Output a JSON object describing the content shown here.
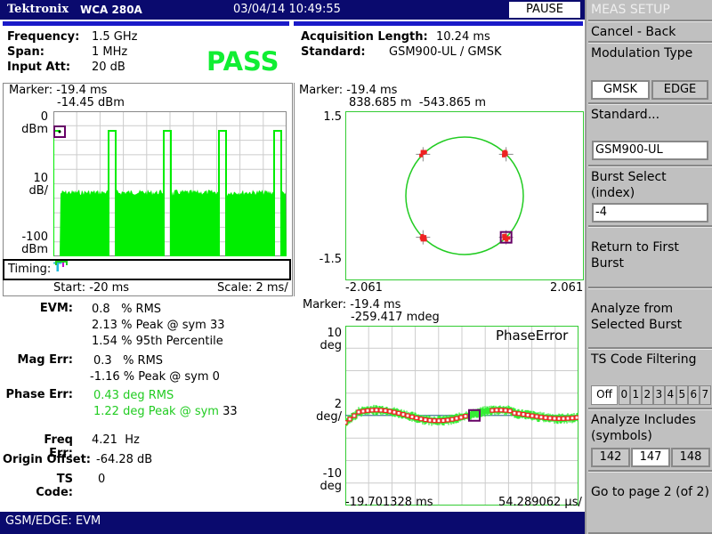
{
  "titlebar": {
    "brand": "Tektronix",
    "model": "WCA 280A",
    "datetime": "03/04/14 10:49:55",
    "pause_label": "PAUSE"
  },
  "header": {
    "frequency_label": "Frequency:",
    "frequency": "1.5 GHz",
    "span_label": "Span:",
    "span": "1 MHz",
    "input_att_label": "Input Att:",
    "input_att": "20 dB",
    "verdict": "PASS",
    "acq_label": "Acquisition Length:",
    "acq": "10.24 ms",
    "standard_label": "Standard:",
    "standard": "GSM900-UL / GMSK"
  },
  "power_vs_time": {
    "marker_line1": "Marker: -19.4 ms",
    "marker_line2": "-14.45 dBm",
    "y_top": "0",
    "y_top_unit": "dBm",
    "y_scale": "10",
    "y_scale_unit": "dB/",
    "y_bottom": "-100",
    "y_bottom_unit": "dBm",
    "timing_label": "Timing:",
    "start": "Start: -20 ms",
    "scale": "Scale: 2 ms/",
    "trace_color": "#00ee00"
  },
  "constellation": {
    "marker_line1": "Marker: -19.4 ms",
    "marker_line2": "838.685 m  -543.865 m",
    "y_top": "1.5",
    "y_bottom": "-1.5",
    "x_left": "-2.061",
    "x_right": "2.061"
  },
  "phase_error": {
    "marker_line1": "Marker: -19.4 ms",
    "marker_line2": "-259.417 mdeg",
    "title": "PhaseError",
    "y_top": "10",
    "y_top_unit": "deg",
    "y_mid": "2",
    "y_mid_unit": "deg/",
    "y_bottom": "-10",
    "y_bottom_unit": "deg",
    "x_start": "-19.701328 ms",
    "x_scale": "54.289062 µs/"
  },
  "results": {
    "evm_label": "EVM:",
    "evm": [
      "0.8   % RMS",
      "2.13 % Peak @ sym 33",
      "1.54 % 95th Percentile"
    ],
    "mag_label": "Mag Err:",
    "mag": [
      "0.3   % RMS",
      "-1.16 % Peak @ sym 0"
    ],
    "phase_label": "Phase Err:",
    "phase": [
      "0.43 deg RMS",
      "1.22 deg Peak @ sym "
    ],
    "phase_sym": "33",
    "freq_label": "Freq Err:",
    "freq": "4.21  Hz",
    "origin_label": "Origin Offset:",
    "origin": "-64.28 dB",
    "ts_label": "TS Code:",
    "ts": "0"
  },
  "statusbar": "GSM/EDGE: EVM",
  "softkeys": {
    "menu_title": "MEAS SETUP",
    "cancel": "Cancel - Back",
    "modulation": "Modulation Type",
    "mod_options": [
      "GMSK",
      "EDGE"
    ],
    "mod_selected": "GMSK",
    "standard": "Standard...",
    "standard_value": "GSM900-UL",
    "burst": "Burst Select (index)",
    "burst_value": "-4",
    "return_first": "Return to First Burst",
    "analyze_selected": "Analyze from Selected Burst",
    "ts_filter": "TS Code Filtering",
    "ts_options": [
      "Off",
      "0",
      "1",
      "2",
      "3",
      "4",
      "5",
      "6",
      "7"
    ],
    "ts_selected": "Off",
    "analyze_includes": "Analyze Includes (symbols)",
    "sym_options": [
      "142",
      "147",
      "148"
    ],
    "sym_selected": "147",
    "goto_page": "Go to page 2 (of 2)"
  }
}
